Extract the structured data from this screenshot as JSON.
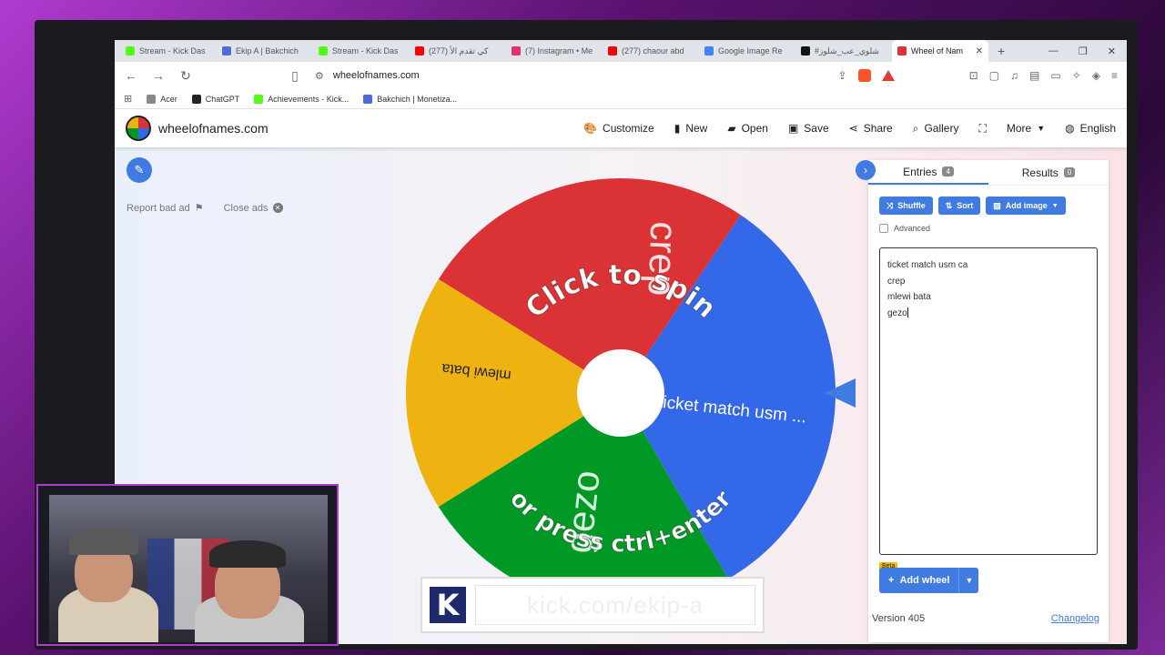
{
  "browser": {
    "tabs": [
      {
        "label": "Stream - Kick Das",
        "color": "#53fc18",
        "active": false
      },
      {
        "label": "Ekip A | Bakchich",
        "color": "#4f6bd9",
        "active": false
      },
      {
        "label": "Stream - Kick Das",
        "color": "#53fc18",
        "active": false
      },
      {
        "label": "(277) كي تقدم الأ",
        "color": "#ff0000",
        "active": false
      },
      {
        "label": "(7) Instagram • Me",
        "color": "#e1306c",
        "active": false
      },
      {
        "label": "(277) chaour abd",
        "color": "#ff0000",
        "active": false
      },
      {
        "label": "Google Image Re",
        "color": "#4285f4",
        "active": false
      },
      {
        "label": "#شلوي_عب_شلوز",
        "color": "#111111",
        "active": false
      },
      {
        "label": "Wheel of Nam",
        "color": "#db3236",
        "active": true
      }
    ],
    "url": "wheelofnames.com",
    "bookmarks": [
      {
        "label": "Acer",
        "color": "#888888"
      },
      {
        "label": "ChatGPT",
        "color": "#222222"
      },
      {
        "label": "Achievements - Kick...",
        "color": "#53fc18"
      },
      {
        "label": "Bakchich | Monetiza...",
        "color": "#4f6bd9"
      }
    ]
  },
  "site": {
    "name": "wheelofnames.com",
    "menu": {
      "customize": "Customize",
      "new": "New",
      "open": "Open",
      "save": "Save",
      "share": "Share",
      "gallery": "Gallery",
      "more": "More",
      "language": "English"
    },
    "report_ad": "Report bad ad",
    "close_ads": "Close ads"
  },
  "wheel": {
    "center_text_top": "Click to spin",
    "center_text_bottom": "or press ctrl+enter",
    "segments": [
      {
        "label": "ticket match usm ...",
        "color": "#3369e8"
      },
      {
        "label": "crep",
        "color": "#db3236"
      },
      {
        "label": "mlewi bata",
        "color": "#eeb211"
      },
      {
        "label": "gezo",
        "color": "#009925"
      }
    ]
  },
  "panel": {
    "entries_tab": "Entries",
    "entries_count": "4",
    "results_tab": "Results",
    "results_count": "0",
    "shuffle": "Shuffle",
    "sort": "Sort",
    "add_image": "Add image",
    "advanced": "Advanced",
    "entries": [
      "ticket match usm ca",
      "crep",
      "mlewi bata",
      "gezo"
    ],
    "beta": "Beta",
    "add_wheel": "Add wheel",
    "version": "Version 405",
    "changelog": "Changelog"
  },
  "overlay": {
    "kick_url": "kick.com/ekip-a",
    "kick_logo": "K"
  }
}
